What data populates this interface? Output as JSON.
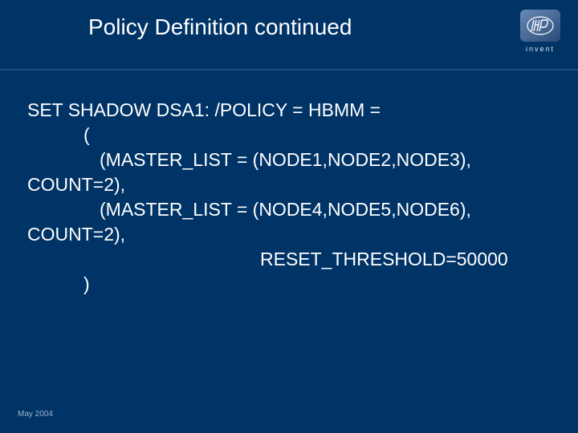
{
  "header": {
    "title": "Policy Definition continued",
    "logo_text": "invent"
  },
  "code": {
    "l1": "SET SHADOW DSA1: /POLICY = HBMM =",
    "l2": "(",
    "l3": "(MASTER_LIST = (NODE1,NODE2,NODE3),",
    "l4": "COUNT=2),",
    "l5": "(MASTER_LIST = (NODE4,NODE5,NODE6),",
    "l6": "COUNT=2),",
    "l7": "RESET_THRESHOLD=50000",
    "l8": ")"
  },
  "footer": {
    "date": "May 2004"
  }
}
